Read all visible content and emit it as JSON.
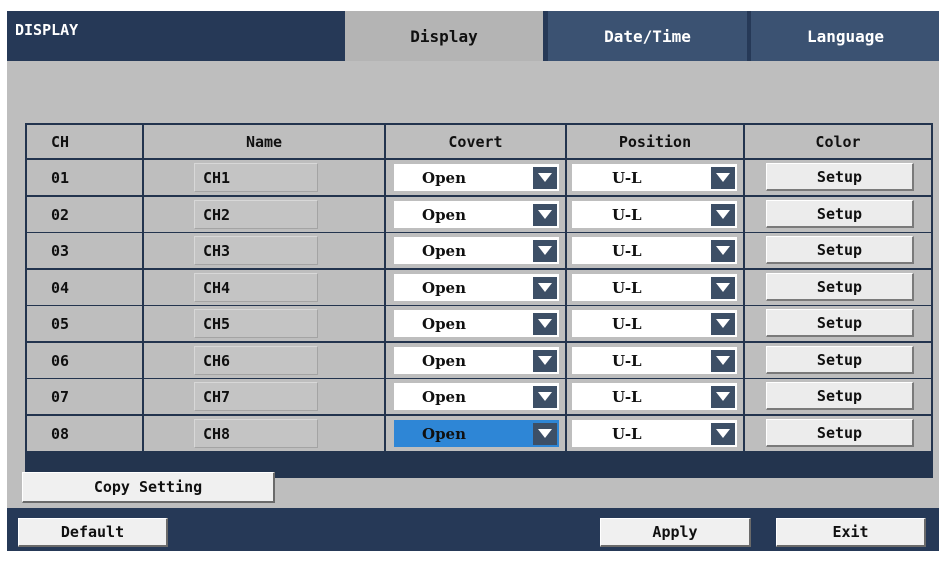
{
  "header": {
    "title": "DISPLAY",
    "tabs": [
      {
        "label": "Display",
        "active": true
      },
      {
        "label": "Date/Time",
        "active": false
      },
      {
        "label": "Language",
        "active": false
      }
    ]
  },
  "table": {
    "columns": [
      "CH",
      "Name",
      "Covert",
      "Position",
      "Color"
    ],
    "rows": [
      {
        "ch": "01",
        "name": "CH1",
        "covert": "Open",
        "position": "U-L",
        "color": "Setup"
      },
      {
        "ch": "02",
        "name": "CH2",
        "covert": "Open",
        "position": "U-L",
        "color": "Setup"
      },
      {
        "ch": "03",
        "name": "CH3",
        "covert": "Open",
        "position": "U-L",
        "color": "Setup"
      },
      {
        "ch": "04",
        "name": "CH4",
        "covert": "Open",
        "position": "U-L",
        "color": "Setup"
      },
      {
        "ch": "05",
        "name": "CH5",
        "covert": "Open",
        "position": "U-L",
        "color": "Setup"
      },
      {
        "ch": "06",
        "name": "CH6",
        "covert": "Open",
        "position": "U-L",
        "color": "Setup"
      },
      {
        "ch": "07",
        "name": "CH7",
        "covert": "Open",
        "position": "U-L",
        "color": "Setup"
      },
      {
        "ch": "08",
        "name": "CH8",
        "covert": "Open",
        "position": "U-L",
        "color": "Setup",
        "covert_selected": true
      }
    ]
  },
  "actions": {
    "copy_setting": "Copy Setting",
    "default": "Default",
    "apply": "Apply",
    "exit": "Exit"
  },
  "colors": {
    "titlebar": "#263957",
    "tab_inactive": "#3b5272",
    "tab_active": "#b4b4b4",
    "selected_field": "#2e86d6"
  },
  "icons": {
    "dropdown": "chevron-down-icon"
  }
}
